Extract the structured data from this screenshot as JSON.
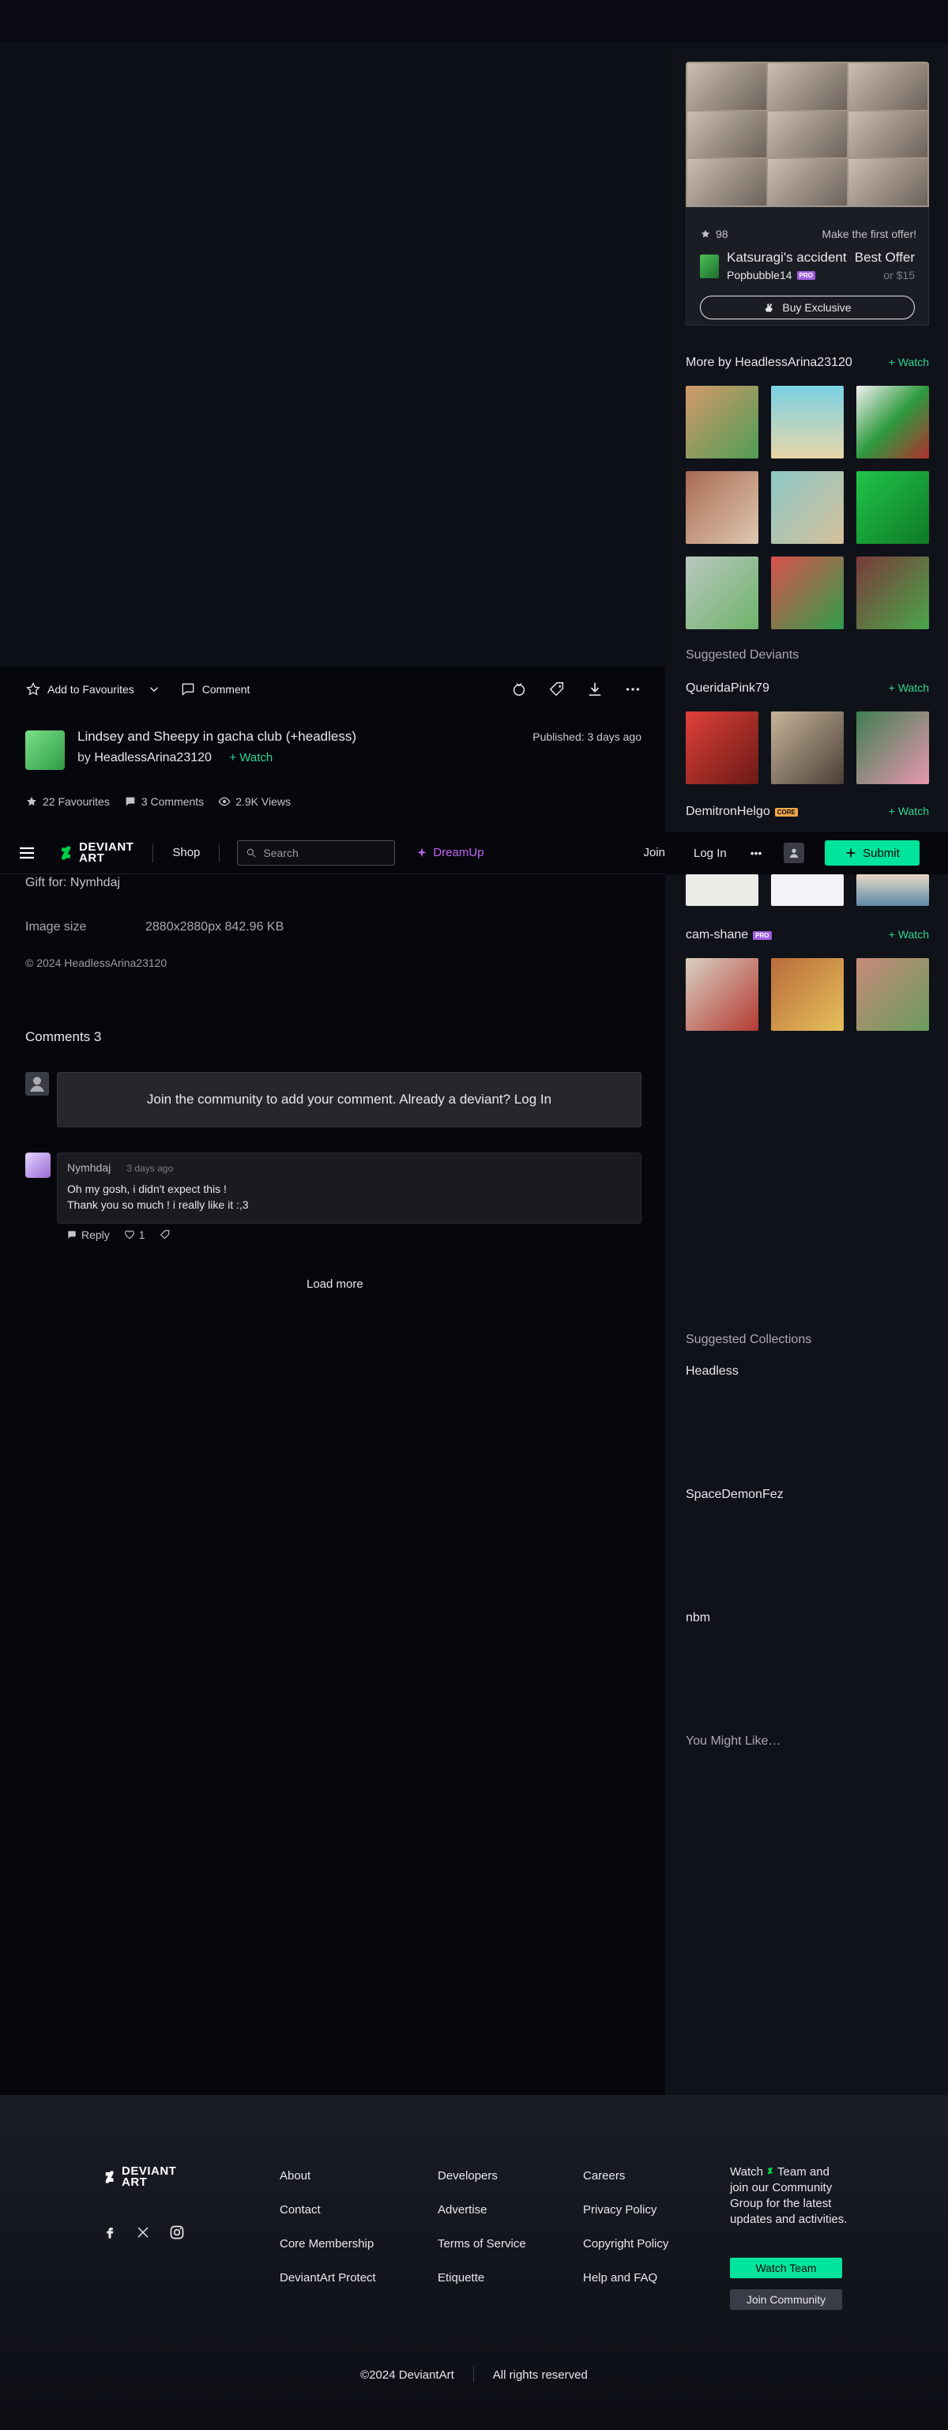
{
  "actions": {
    "favourite": "Add to Favourites",
    "comment": "Comment"
  },
  "deviation": {
    "title": "Lindsey and Sheepy in gacha club (+headless)",
    "by_prefix": "by",
    "author": "HeadlessArina23120",
    "watch": "Watch",
    "published": "Published: 3 days ago",
    "stats": {
      "favourites": "22 Favourites",
      "comments": "3 Comments",
      "views": "2.9K Views"
    },
    "gift": "Gift for: Nymhdaj",
    "image_size_label": "Image size",
    "image_size_value": "2880x2880px 842.96 KB",
    "copyright": "© 2024 HeadlessArina23120"
  },
  "nav": {
    "logo_line1": "DEVIANT",
    "logo_line2": "ART",
    "shop": "Shop",
    "search_placeholder": "Search",
    "dreamup": "DreamUp",
    "join": "Join",
    "login": "Log In",
    "more": "•••",
    "submit": "Submit"
  },
  "comments": {
    "heading": "Comments 3",
    "join_prompt": "Join the community to add your comment. Already a deviant? Log In",
    "items": [
      {
        "user": "Nymhdaj",
        "time": "3 days ago",
        "line1": "Oh my gosh, i didn't expect this !",
        "line2": "Thank you so much ! i really like it :,3",
        "reply": "Reply",
        "likes": "1"
      }
    ],
    "load_more": "Load more"
  },
  "shop_card": {
    "favs": "98",
    "offer_prompt": "Make the first offer!",
    "title": "Katsuragi's accident",
    "seller": "Popbubble14",
    "seller_badge": "PRO",
    "best_offer": "Best Offer",
    "price": "or $15",
    "buy": "Buy Exclusive"
  },
  "sidebar": {
    "more_by": "More by HeadlessArina23120",
    "watch": "Watch",
    "more_thumbs": [
      [
        "#4f9c56",
        "#7ad1e4",
        "#2d9a3e"
      ],
      [
        "#a86b52",
        "#8bc8c6",
        "#20c44a"
      ],
      [
        "#6fb46a",
        "#d9514d",
        "#7a3a3a"
      ]
    ],
    "suggested_heading": "Suggested Deviants",
    "deviants": [
      {
        "name": "QueridaPink79",
        "badge": "",
        "thumbs": [
          "#b2382c",
          "#6b5a4e",
          "#c98a7a"
        ]
      },
      {
        "name": "DemitronHelgo",
        "badge": "CORE",
        "thumbs": [
          "#e8e8ea",
          "#eef0f4",
          "#5c8aa8"
        ]
      },
      {
        "name": "cam-shane",
        "badge": "PRO",
        "thumbs": [
          "#d9d0c2",
          "#b96b3c",
          "#c88a7a"
        ]
      }
    ],
    "collections_heading": "Suggested Collections",
    "collections": [
      "Headless",
      "SpaceDemonFez",
      "nbm"
    ],
    "might_like": "You Might Like…"
  },
  "footer": {
    "logo_line1": "DEVIANT",
    "logo_line2": "ART",
    "col1": [
      "About",
      "Contact",
      "Core Membership",
      "DeviantArt Protect"
    ],
    "col2": [
      "Developers",
      "Advertise",
      "Terms of Service",
      "Etiquette"
    ],
    "col3": [
      "Careers",
      "Privacy Policy",
      "Copyright Policy",
      "Help and FAQ"
    ],
    "watch_text_1": "Watch",
    "watch_text_2": "Team and join our Community Group for the latest updates and activities.",
    "watch_team": "Watch Team",
    "join_community": "Join Community",
    "copyright": "©2024 DeviantArt",
    "rights": "All rights reserved"
  }
}
